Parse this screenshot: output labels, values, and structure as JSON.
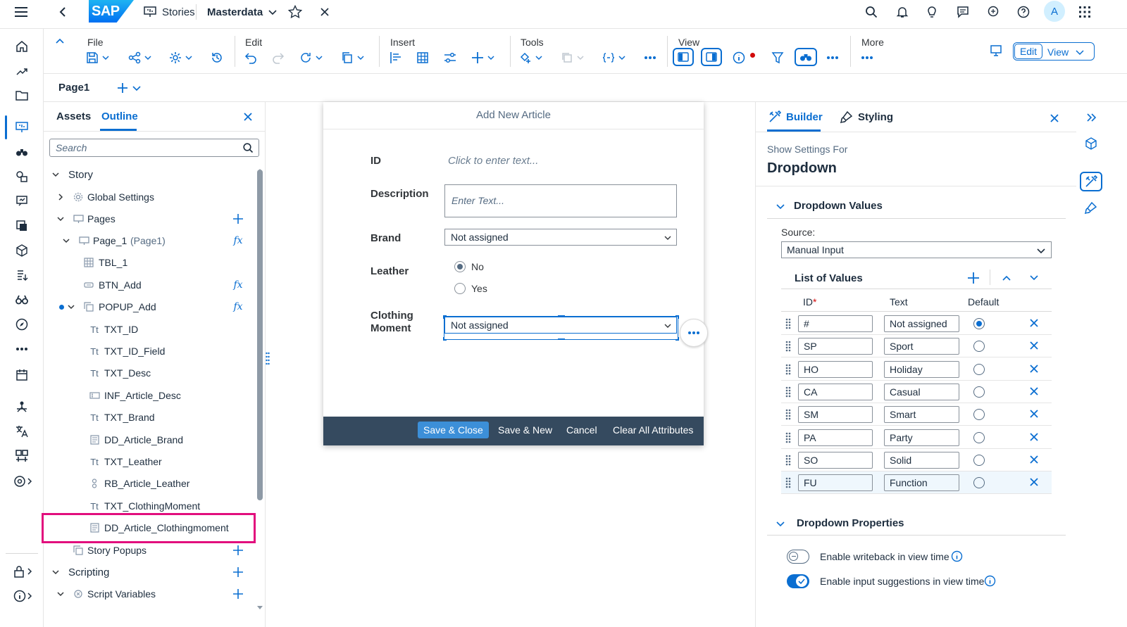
{
  "shell": {
    "logo": "SAP",
    "app_name": "Stories",
    "document": "Masterdata",
    "avatar_letter": "A"
  },
  "toolbar": {
    "groups": {
      "file": "File",
      "edit": "Edit",
      "insert": "Insert",
      "tools": "Tools",
      "view": "View",
      "more": "More"
    },
    "edit_label": "Edit",
    "view_label": "View"
  },
  "pagetabs": {
    "page1": "Page1"
  },
  "outline": {
    "tabs": {
      "assets": "Assets",
      "outline": "Outline"
    },
    "search_placeholder": "Search",
    "tree": {
      "story": "Story",
      "global_settings": "Global Settings",
      "pages": "Pages",
      "page_1": "Page_1",
      "page_1_alias": "(Page1)",
      "tbl_1": "TBL_1",
      "btn_add": "BTN_Add",
      "popup_add": "POPUP_Add",
      "txt_id": "TXT_ID",
      "txt_id_field": "TXT_ID_Field",
      "txt_desc": "TXT_Desc",
      "inf_article_desc": "INF_Article_Desc",
      "txt_brand": "TXT_Brand",
      "dd_article_brand": "DD_Article_Brand",
      "txt_leather": "TXT_Leather",
      "rb_article_leather": "RB_Article_Leather",
      "txt_clothingmoment": "TXT_ClothingMoment",
      "dd_article_clothingmoment": "DD_Article_Clothingmoment",
      "story_popups": "Story Popups",
      "scripting": "Scripting",
      "script_variables": "Script Variables"
    }
  },
  "dialog": {
    "title": "Add New Article",
    "id_label": "ID",
    "id_placeholder": "Click to enter text...",
    "desc_label": "Description",
    "desc_placeholder": "Enter Text...",
    "brand_label": "Brand",
    "brand_value": "Not assigned",
    "leather_label": "Leather",
    "leather_no": "No",
    "leather_yes": "Yes",
    "clothing_label_1": "Clothing",
    "clothing_label_2": "Moment",
    "clothing_value": "Not assigned",
    "buttons": {
      "save_close": "Save & Close",
      "save_new": "Save & New",
      "cancel": "Cancel",
      "clear": "Clear All Attributes"
    }
  },
  "rpanel": {
    "tabs": {
      "builder": "Builder",
      "styling": "Styling"
    },
    "show_settings_for": "Show Settings For",
    "widget_type": "Dropdown",
    "dropdown_values": "Dropdown Values",
    "source_label": "Source:",
    "source_value": "Manual Input",
    "list_of_values": "List of Values",
    "columns": {
      "id": "ID",
      "required": "*",
      "text": "Text",
      "default": "Default"
    },
    "values": [
      {
        "id": "#",
        "text": "Not assigned",
        "default": true
      },
      {
        "id": "SP",
        "text": "Sport",
        "default": false
      },
      {
        "id": "HO",
        "text": "Holiday",
        "default": false
      },
      {
        "id": "CA",
        "text": "Casual",
        "default": false
      },
      {
        "id": "SM",
        "text": "Smart",
        "default": false
      },
      {
        "id": "PA",
        "text": "Party",
        "default": false
      },
      {
        "id": "SO",
        "text": "Solid",
        "default": false
      },
      {
        "id": "FU",
        "text": "Function",
        "default": false
      }
    ],
    "dropdown_properties": "Dropdown Properties",
    "writeback_label": "Enable writeback in view time",
    "writeback_on": false,
    "suggestions_label": "Enable input suggestions in view time",
    "suggestions_on": true
  },
  "colors": {
    "accent": "#0a6ed1",
    "footer": "#354a5f",
    "highlight": "#e20e7d",
    "primary_button": "#3c8fd8"
  }
}
